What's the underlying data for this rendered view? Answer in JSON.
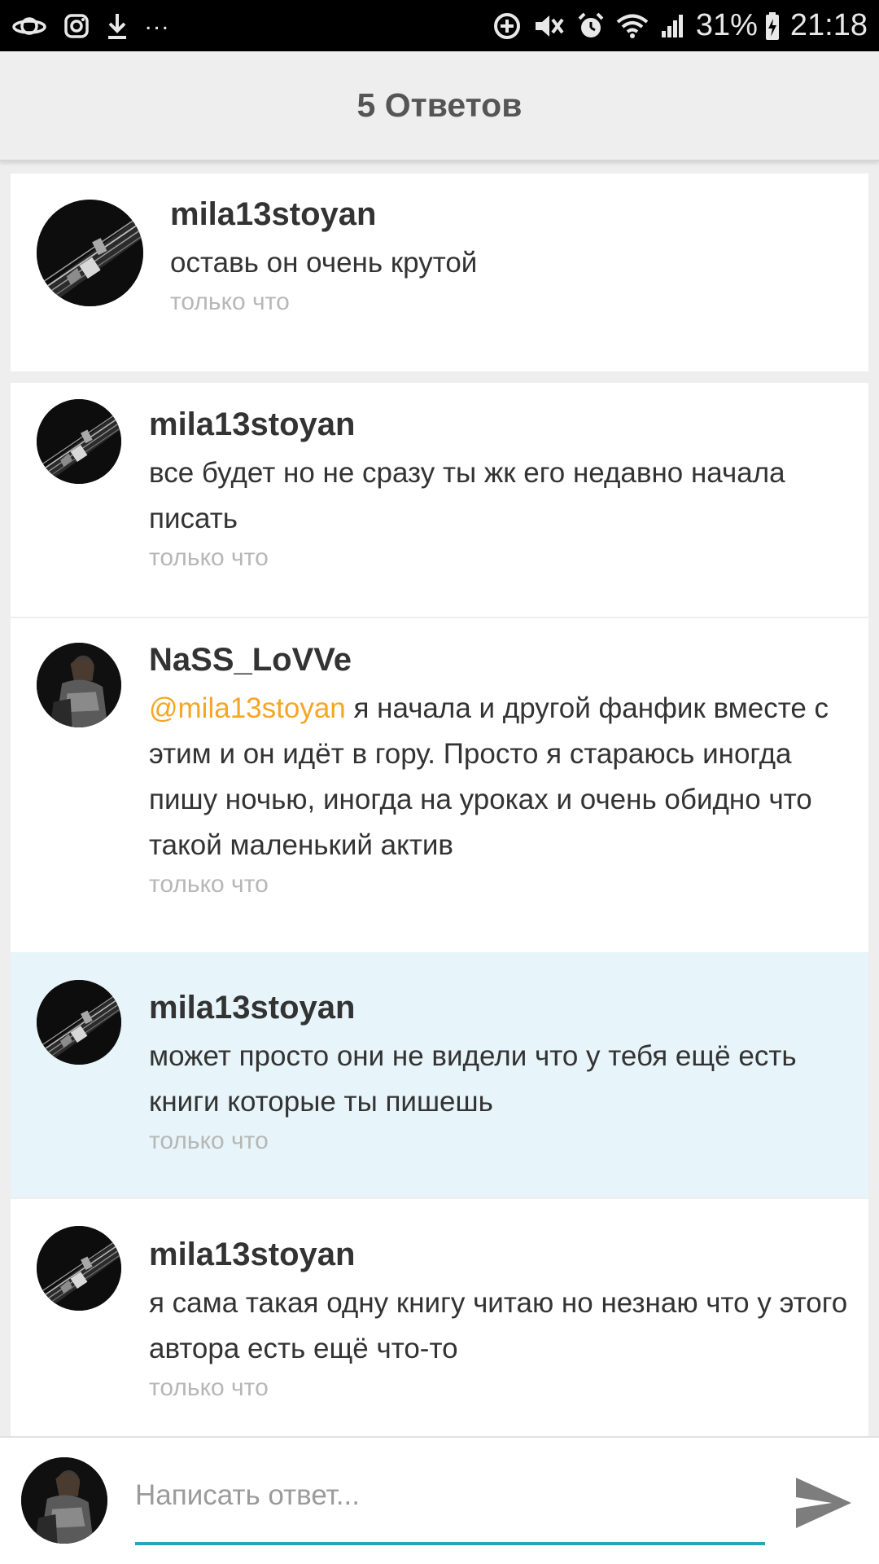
{
  "status_bar": {
    "battery_percent": "31%",
    "time": "21:18",
    "overflow_dots": "...",
    "icons": [
      "saturn-icon",
      "instagram-icon",
      "download-icon",
      "data-saver-icon",
      "mute-icon",
      "alarm-icon",
      "wifi-icon",
      "signal-icon",
      "battery-charging-icon"
    ]
  },
  "header": {
    "title": "5 Ответов"
  },
  "comments": [
    {
      "username": "mila13stoyan",
      "text": "оставь он очень крутой",
      "time": "только что",
      "avatar": "guitar-avatar"
    },
    {
      "username": "mila13stoyan",
      "text": "все будет но не сразу ты жк его недавно начала писать",
      "time": "только что",
      "avatar": "guitar-avatar"
    },
    {
      "username": "NaSS_LoVVe",
      "mention": "@mila13stoyan",
      "text": " я начала и другой фанфик вместе с этим и он идёт в гору. Просто я стараюсь иногда пишу ночью, иногда на уроках и очень обидно что такой маленький актив",
      "time": "только что",
      "avatar": "person-avatar"
    },
    {
      "username": "mila13stoyan",
      "text": "может просто они не видели что у тебя ещё есть книги которые ты пишешь",
      "time": "только что",
      "avatar": "guitar-avatar",
      "highlighted": true
    },
    {
      "username": "mila13stoyan",
      "text": "я сама такая одну книгу читаю но незнаю что у этого автора есть ещё что-то",
      "time": "только что",
      "avatar": "guitar-avatar"
    }
  ],
  "reply": {
    "placeholder": "Написать ответ..."
  },
  "colors": {
    "mention": "#f5a623",
    "accent_underline": "#27a6b8",
    "highlight_background": "#e7f4f9",
    "timestamp": "#b7b7b7"
  }
}
